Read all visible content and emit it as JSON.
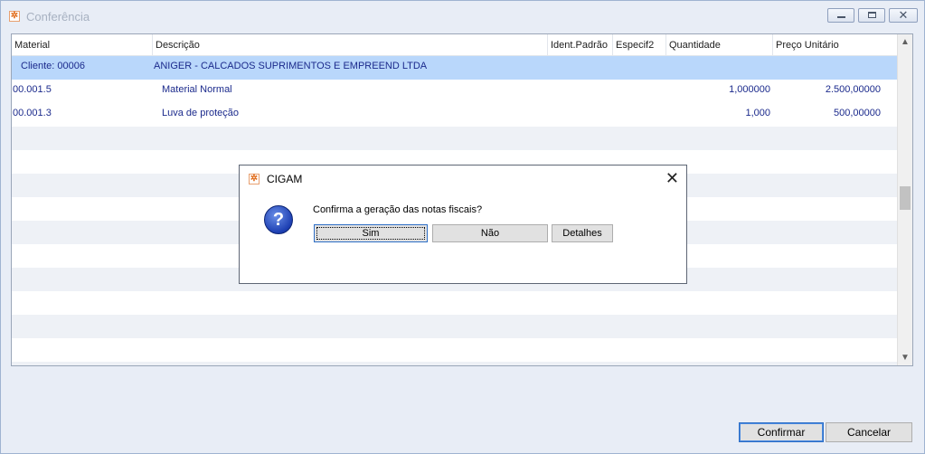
{
  "window": {
    "title": "Conferência"
  },
  "grid": {
    "columns": [
      "Material",
      "Descrição",
      "Ident.Padrão",
      "Especif2",
      "Quantidade",
      "Preço Unitário"
    ],
    "group": {
      "label": "Cliente:  00006",
      "description": "ANIGER - CALCADOS SUPRIMENTOS E EMPREEND LTDA"
    },
    "rows": [
      {
        "material": "00.001.5",
        "descricao": "Material Normal",
        "quantidade": "1,000000",
        "preco": "2.500,00000"
      },
      {
        "material": "00.001.3",
        "descricao": "Luva de proteção",
        "quantidade": "1,000",
        "preco": "500,00000"
      }
    ]
  },
  "buttons": {
    "confirm": "Confirmar",
    "cancel": "Cancelar"
  },
  "dialog": {
    "title": "CIGAM",
    "message": "Confirma a geração das notas fiscais?",
    "yes": "Sim",
    "no": "Não",
    "details": "Detalhes"
  }
}
